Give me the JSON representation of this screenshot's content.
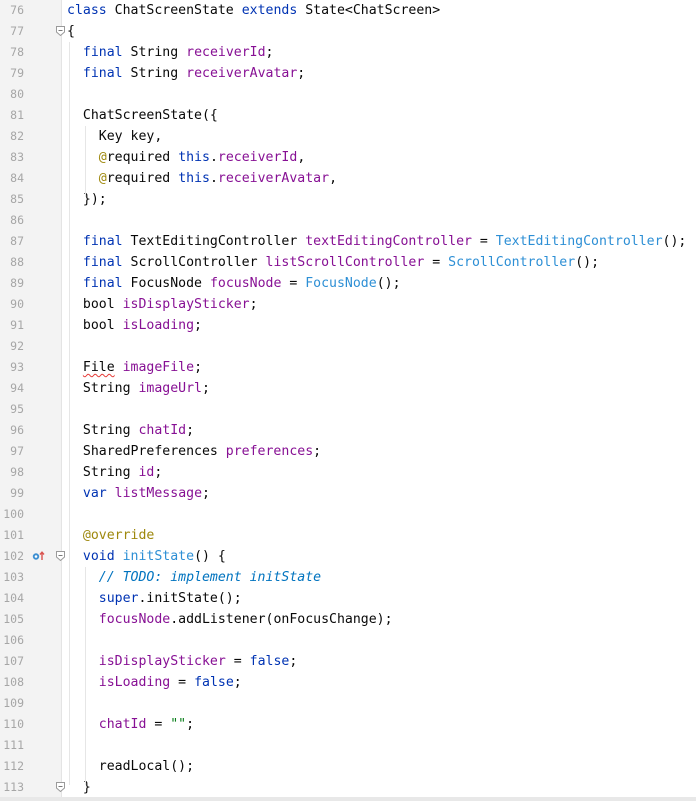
{
  "editor": {
    "lines": [
      {
        "n": "76",
        "t": [
          [
            "kw",
            "class"
          ],
          [
            "p",
            " ChatScreenState "
          ],
          [
            "kw",
            "extends"
          ],
          [
            "p",
            " State<ChatScreen>"
          ]
        ]
      },
      {
        "n": "77",
        "t": [
          [
            "p",
            "{"
          ]
        ]
      },
      {
        "n": "78",
        "t": [
          [
            "p",
            "  "
          ],
          [
            "kw",
            "final"
          ],
          [
            "p",
            " String "
          ],
          [
            "field",
            "receiverId"
          ],
          [
            "p",
            ";"
          ]
        ]
      },
      {
        "n": "79",
        "t": [
          [
            "p",
            "  "
          ],
          [
            "kw",
            "final"
          ],
          [
            "p",
            " String "
          ],
          [
            "field",
            "receiverAvatar"
          ],
          [
            "p",
            ";"
          ]
        ]
      },
      {
        "n": "80",
        "t": []
      },
      {
        "n": "81",
        "t": [
          [
            "p",
            "  ChatScreenState({"
          ]
        ]
      },
      {
        "n": "82",
        "t": [
          [
            "p",
            "    Key key,"
          ]
        ]
      },
      {
        "n": "83",
        "t": [
          [
            "p",
            "    "
          ],
          [
            "ann",
            "@"
          ],
          [
            "p",
            "required "
          ],
          [
            "kw",
            "this"
          ],
          [
            "p",
            "."
          ],
          [
            "field",
            "receiverId"
          ],
          [
            "p",
            ","
          ]
        ]
      },
      {
        "n": "84",
        "t": [
          [
            "p",
            "    "
          ],
          [
            "ann",
            "@"
          ],
          [
            "p",
            "required "
          ],
          [
            "kw",
            "this"
          ],
          [
            "p",
            "."
          ],
          [
            "field",
            "receiverAvatar"
          ],
          [
            "p",
            ","
          ]
        ]
      },
      {
        "n": "85",
        "t": [
          [
            "p",
            "  });"
          ]
        ]
      },
      {
        "n": "86",
        "t": []
      },
      {
        "n": "87",
        "t": [
          [
            "p",
            "  "
          ],
          [
            "kw",
            "final"
          ],
          [
            "p",
            " TextEditingController "
          ],
          [
            "field",
            "textEditingController"
          ],
          [
            "p",
            " = "
          ],
          [
            "cls",
            "TextEditingController"
          ],
          [
            "p",
            "();"
          ]
        ]
      },
      {
        "n": "88",
        "t": [
          [
            "p",
            "  "
          ],
          [
            "kw",
            "final"
          ],
          [
            "p",
            " ScrollController "
          ],
          [
            "field",
            "listScrollController"
          ],
          [
            "p",
            " = "
          ],
          [
            "cls",
            "ScrollController"
          ],
          [
            "p",
            "();"
          ]
        ]
      },
      {
        "n": "89",
        "t": [
          [
            "p",
            "  "
          ],
          [
            "kw",
            "final"
          ],
          [
            "p",
            " FocusNode "
          ],
          [
            "field",
            "focusNode"
          ],
          [
            "p",
            " = "
          ],
          [
            "cls",
            "FocusNode"
          ],
          [
            "p",
            "();"
          ]
        ]
      },
      {
        "n": "90",
        "t": [
          [
            "p",
            "  bool "
          ],
          [
            "field",
            "isDisplaySticker"
          ],
          [
            "p",
            ";"
          ]
        ]
      },
      {
        "n": "91",
        "t": [
          [
            "p",
            "  bool "
          ],
          [
            "field",
            "isLoading"
          ],
          [
            "p",
            ";"
          ]
        ]
      },
      {
        "n": "92",
        "t": []
      },
      {
        "n": "93",
        "t": [
          [
            "p",
            "  "
          ],
          [
            "sq",
            "File"
          ],
          [
            "p",
            " "
          ],
          [
            "field",
            "imageFile"
          ],
          [
            "p",
            ";"
          ]
        ]
      },
      {
        "n": "94",
        "t": [
          [
            "p",
            "  String "
          ],
          [
            "field",
            "imageUrl"
          ],
          [
            "p",
            ";"
          ]
        ]
      },
      {
        "n": "95",
        "t": []
      },
      {
        "n": "96",
        "t": [
          [
            "p",
            "  String "
          ],
          [
            "field",
            "chatId"
          ],
          [
            "p",
            ";"
          ]
        ]
      },
      {
        "n": "97",
        "t": [
          [
            "p",
            "  SharedPreferences "
          ],
          [
            "field",
            "preferences"
          ],
          [
            "p",
            ";"
          ]
        ]
      },
      {
        "n": "98",
        "t": [
          [
            "p",
            "  String "
          ],
          [
            "field",
            "id"
          ],
          [
            "p",
            ";"
          ]
        ]
      },
      {
        "n": "99",
        "t": [
          [
            "p",
            "  "
          ],
          [
            "kw",
            "var"
          ],
          [
            "p",
            " "
          ],
          [
            "field",
            "listMessage"
          ],
          [
            "p",
            ";"
          ]
        ]
      },
      {
        "n": "100",
        "t": []
      },
      {
        "n": "101",
        "t": [
          [
            "p",
            "  "
          ],
          [
            "ann",
            "@override"
          ]
        ]
      },
      {
        "n": "102",
        "t": [
          [
            "p",
            "  "
          ],
          [
            "kw",
            "void"
          ],
          [
            "p",
            " "
          ],
          [
            "cls",
            "initState"
          ],
          [
            "p",
            "() {"
          ]
        ]
      },
      {
        "n": "103",
        "t": [
          [
            "p",
            "    "
          ],
          [
            "cmt",
            "// TODO: implement initState"
          ]
        ]
      },
      {
        "n": "104",
        "t": [
          [
            "p",
            "    "
          ],
          [
            "kw",
            "super"
          ],
          [
            "p",
            ".initState();"
          ]
        ]
      },
      {
        "n": "105",
        "t": [
          [
            "p",
            "    "
          ],
          [
            "field",
            "focusNode"
          ],
          [
            "p",
            ".addListener(onFocusChange);"
          ]
        ]
      },
      {
        "n": "106",
        "t": []
      },
      {
        "n": "107",
        "t": [
          [
            "p",
            "    "
          ],
          [
            "field",
            "isDisplaySticker"
          ],
          [
            "p",
            " = "
          ],
          [
            "kw",
            "false"
          ],
          [
            "p",
            ";"
          ]
        ]
      },
      {
        "n": "108",
        "t": [
          [
            "p",
            "    "
          ],
          [
            "field",
            "isLoading"
          ],
          [
            "p",
            " = "
          ],
          [
            "kw",
            "false"
          ],
          [
            "p",
            ";"
          ]
        ]
      },
      {
        "n": "109",
        "t": []
      },
      {
        "n": "110",
        "t": [
          [
            "p",
            "    "
          ],
          [
            "field",
            "chatId"
          ],
          [
            "p",
            " = "
          ],
          [
            "str",
            "\"\""
          ],
          [
            "p",
            ";"
          ]
        ]
      },
      {
        "n": "111",
        "t": []
      },
      {
        "n": "112",
        "t": [
          [
            "p",
            "    readLocal();"
          ]
        ]
      },
      {
        "n": "113",
        "t": [
          [
            "p",
            "  }"
          ]
        ]
      }
    ]
  },
  "gutter": {
    "fold_icons": [
      "77",
      "102",
      "113"
    ],
    "override_marker_line": "102",
    "override_marker_icon": "override-method-icon"
  },
  "colors": {
    "keyword": "#0033b3",
    "field": "#871094",
    "annotation": "#9e880d",
    "class_ref": "#2d8fd5",
    "string": "#067d17",
    "comment": "#0073bf",
    "error_squiggle": "#e53935"
  }
}
